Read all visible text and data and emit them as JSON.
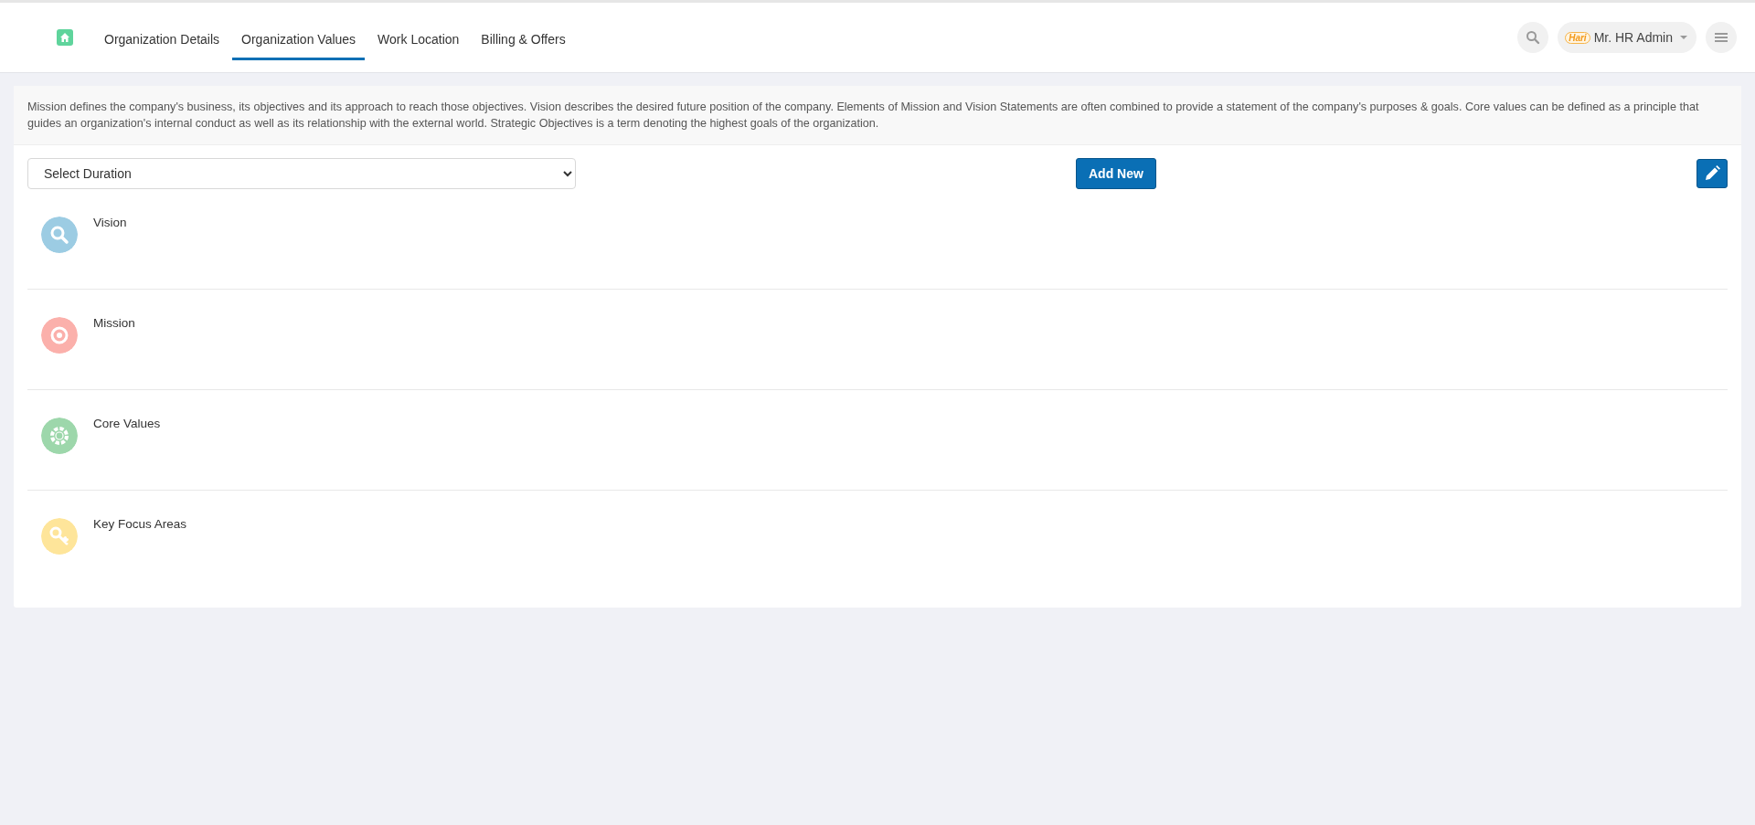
{
  "nav": {
    "tabs": [
      {
        "label": "Organization Details",
        "selected": false
      },
      {
        "label": "Organization Values",
        "selected": true
      },
      {
        "label": "Work Location",
        "selected": false
      },
      {
        "label": "Billing & Offers",
        "selected": false
      }
    ]
  },
  "user": {
    "logo": "Hari",
    "name": "Mr. HR Admin"
  },
  "description": "Mission defines the company's business, its objectives and its approach to reach those objectives. Vision describes the desired future position of the company. Elements of Mission and Vision Statements are often combined to provide a statement of the company's purposes & goals. Core values can be defined as a principle that guides an organization's internal conduct as well as its relationship with the external world. Strategic Objectives is a term denoting the highest goals of the organization.",
  "duration_select": {
    "value": "Select Duration"
  },
  "add_button": "Add New",
  "sections": [
    {
      "title": "Vision",
      "kind": "search",
      "color": "#9ccce3"
    },
    {
      "title": "Mission",
      "kind": "target",
      "color": "#fbb0ab"
    },
    {
      "title": "Core Values",
      "kind": "lifebuoy",
      "color": "#9dd7ab"
    },
    {
      "title": "Key Focus Areas",
      "kind": "key",
      "color": "#fee59a"
    }
  ]
}
